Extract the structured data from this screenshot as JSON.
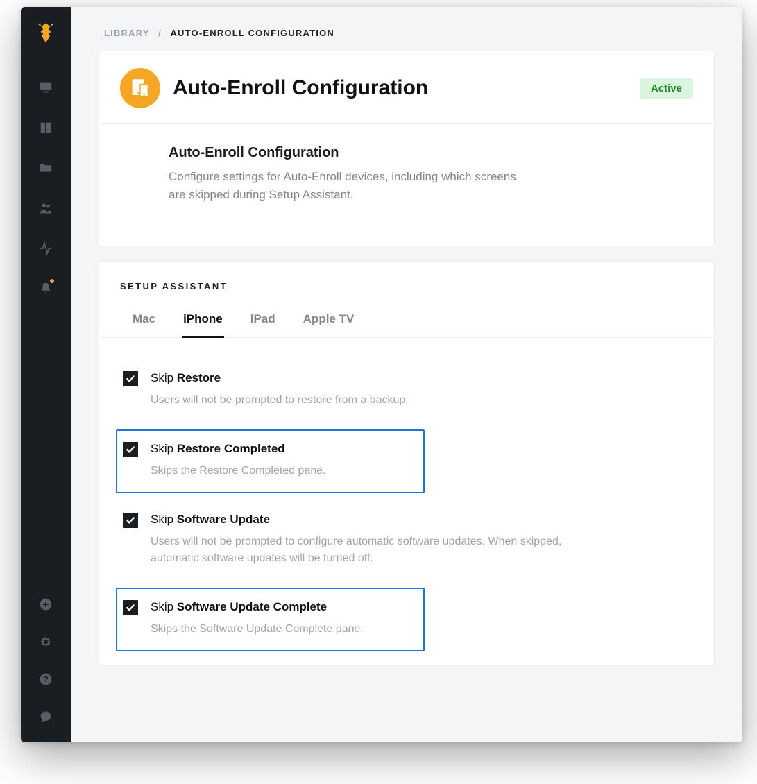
{
  "breadcrumb": {
    "parent": "LIBRARY",
    "current": "AUTO-ENROLL CONFIGURATION"
  },
  "header": {
    "title": "Auto-Enroll Configuration",
    "status": "Active"
  },
  "intro": {
    "heading": "Auto-Enroll Configuration",
    "body": "Configure settings for Auto-Enroll devices, including which screens are skipped during Setup Assistant."
  },
  "section_title": "SETUP ASSISTANT",
  "tabs": [
    {
      "label": "Mac",
      "active": false
    },
    {
      "label": "iPhone",
      "active": true
    },
    {
      "label": "iPad",
      "active": false
    },
    {
      "label": "Apple TV",
      "active": false
    }
  ],
  "options": [
    {
      "checked": true,
      "highlight": false,
      "prefix": "Skip ",
      "bold": "Restore",
      "desc": "Users will not be prompted to restore from a backup."
    },
    {
      "checked": true,
      "highlight": true,
      "prefix": "Skip ",
      "bold": "Restore Completed",
      "desc": "Skips the Restore Completed pane."
    },
    {
      "checked": true,
      "highlight": false,
      "prefix": "Skip ",
      "bold": "Software Update",
      "desc": "Users will not be prompted to configure automatic software updates. When skipped, automatic software updates will be turned off."
    },
    {
      "checked": true,
      "highlight": true,
      "prefix": "Skip ",
      "bold": "Software Update Complete",
      "desc": "Skips the Software Update Complete pane."
    }
  ]
}
